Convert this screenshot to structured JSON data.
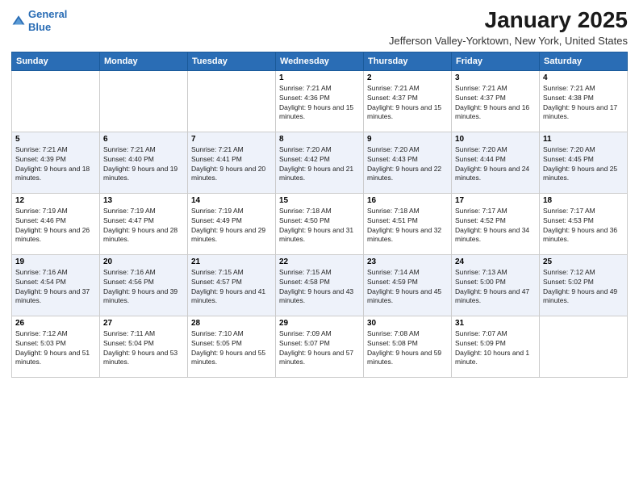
{
  "header": {
    "logo_line1": "General",
    "logo_line2": "Blue",
    "title": "January 2025",
    "subtitle": "Jefferson Valley-Yorktown, New York, United States"
  },
  "days_of_week": [
    "Sunday",
    "Monday",
    "Tuesday",
    "Wednesday",
    "Thursday",
    "Friday",
    "Saturday"
  ],
  "weeks": [
    [
      {
        "day": "",
        "sunrise": "",
        "sunset": "",
        "daylight": ""
      },
      {
        "day": "",
        "sunrise": "",
        "sunset": "",
        "daylight": ""
      },
      {
        "day": "",
        "sunrise": "",
        "sunset": "",
        "daylight": ""
      },
      {
        "day": "1",
        "sunrise": "Sunrise: 7:21 AM",
        "sunset": "Sunset: 4:36 PM",
        "daylight": "Daylight: 9 hours and 15 minutes."
      },
      {
        "day": "2",
        "sunrise": "Sunrise: 7:21 AM",
        "sunset": "Sunset: 4:37 PM",
        "daylight": "Daylight: 9 hours and 15 minutes."
      },
      {
        "day": "3",
        "sunrise": "Sunrise: 7:21 AM",
        "sunset": "Sunset: 4:37 PM",
        "daylight": "Daylight: 9 hours and 16 minutes."
      },
      {
        "day": "4",
        "sunrise": "Sunrise: 7:21 AM",
        "sunset": "Sunset: 4:38 PM",
        "daylight": "Daylight: 9 hours and 17 minutes."
      }
    ],
    [
      {
        "day": "5",
        "sunrise": "Sunrise: 7:21 AM",
        "sunset": "Sunset: 4:39 PM",
        "daylight": "Daylight: 9 hours and 18 minutes."
      },
      {
        "day": "6",
        "sunrise": "Sunrise: 7:21 AM",
        "sunset": "Sunset: 4:40 PM",
        "daylight": "Daylight: 9 hours and 19 minutes."
      },
      {
        "day": "7",
        "sunrise": "Sunrise: 7:21 AM",
        "sunset": "Sunset: 4:41 PM",
        "daylight": "Daylight: 9 hours and 20 minutes."
      },
      {
        "day": "8",
        "sunrise": "Sunrise: 7:20 AM",
        "sunset": "Sunset: 4:42 PM",
        "daylight": "Daylight: 9 hours and 21 minutes."
      },
      {
        "day": "9",
        "sunrise": "Sunrise: 7:20 AM",
        "sunset": "Sunset: 4:43 PM",
        "daylight": "Daylight: 9 hours and 22 minutes."
      },
      {
        "day": "10",
        "sunrise": "Sunrise: 7:20 AM",
        "sunset": "Sunset: 4:44 PM",
        "daylight": "Daylight: 9 hours and 24 minutes."
      },
      {
        "day": "11",
        "sunrise": "Sunrise: 7:20 AM",
        "sunset": "Sunset: 4:45 PM",
        "daylight": "Daylight: 9 hours and 25 minutes."
      }
    ],
    [
      {
        "day": "12",
        "sunrise": "Sunrise: 7:19 AM",
        "sunset": "Sunset: 4:46 PM",
        "daylight": "Daylight: 9 hours and 26 minutes."
      },
      {
        "day": "13",
        "sunrise": "Sunrise: 7:19 AM",
        "sunset": "Sunset: 4:47 PM",
        "daylight": "Daylight: 9 hours and 28 minutes."
      },
      {
        "day": "14",
        "sunrise": "Sunrise: 7:19 AM",
        "sunset": "Sunset: 4:49 PM",
        "daylight": "Daylight: 9 hours and 29 minutes."
      },
      {
        "day": "15",
        "sunrise": "Sunrise: 7:18 AM",
        "sunset": "Sunset: 4:50 PM",
        "daylight": "Daylight: 9 hours and 31 minutes."
      },
      {
        "day": "16",
        "sunrise": "Sunrise: 7:18 AM",
        "sunset": "Sunset: 4:51 PM",
        "daylight": "Daylight: 9 hours and 32 minutes."
      },
      {
        "day": "17",
        "sunrise": "Sunrise: 7:17 AM",
        "sunset": "Sunset: 4:52 PM",
        "daylight": "Daylight: 9 hours and 34 minutes."
      },
      {
        "day": "18",
        "sunrise": "Sunrise: 7:17 AM",
        "sunset": "Sunset: 4:53 PM",
        "daylight": "Daylight: 9 hours and 36 minutes."
      }
    ],
    [
      {
        "day": "19",
        "sunrise": "Sunrise: 7:16 AM",
        "sunset": "Sunset: 4:54 PM",
        "daylight": "Daylight: 9 hours and 37 minutes."
      },
      {
        "day": "20",
        "sunrise": "Sunrise: 7:16 AM",
        "sunset": "Sunset: 4:56 PM",
        "daylight": "Daylight: 9 hours and 39 minutes."
      },
      {
        "day": "21",
        "sunrise": "Sunrise: 7:15 AM",
        "sunset": "Sunset: 4:57 PM",
        "daylight": "Daylight: 9 hours and 41 minutes."
      },
      {
        "day": "22",
        "sunrise": "Sunrise: 7:15 AM",
        "sunset": "Sunset: 4:58 PM",
        "daylight": "Daylight: 9 hours and 43 minutes."
      },
      {
        "day": "23",
        "sunrise": "Sunrise: 7:14 AM",
        "sunset": "Sunset: 4:59 PM",
        "daylight": "Daylight: 9 hours and 45 minutes."
      },
      {
        "day": "24",
        "sunrise": "Sunrise: 7:13 AM",
        "sunset": "Sunset: 5:00 PM",
        "daylight": "Daylight: 9 hours and 47 minutes."
      },
      {
        "day": "25",
        "sunrise": "Sunrise: 7:12 AM",
        "sunset": "Sunset: 5:02 PM",
        "daylight": "Daylight: 9 hours and 49 minutes."
      }
    ],
    [
      {
        "day": "26",
        "sunrise": "Sunrise: 7:12 AM",
        "sunset": "Sunset: 5:03 PM",
        "daylight": "Daylight: 9 hours and 51 minutes."
      },
      {
        "day": "27",
        "sunrise": "Sunrise: 7:11 AM",
        "sunset": "Sunset: 5:04 PM",
        "daylight": "Daylight: 9 hours and 53 minutes."
      },
      {
        "day": "28",
        "sunrise": "Sunrise: 7:10 AM",
        "sunset": "Sunset: 5:05 PM",
        "daylight": "Daylight: 9 hours and 55 minutes."
      },
      {
        "day": "29",
        "sunrise": "Sunrise: 7:09 AM",
        "sunset": "Sunset: 5:07 PM",
        "daylight": "Daylight: 9 hours and 57 minutes."
      },
      {
        "day": "30",
        "sunrise": "Sunrise: 7:08 AM",
        "sunset": "Sunset: 5:08 PM",
        "daylight": "Daylight: 9 hours and 59 minutes."
      },
      {
        "day": "31",
        "sunrise": "Sunrise: 7:07 AM",
        "sunset": "Sunset: 5:09 PM",
        "daylight": "Daylight: 10 hours and 1 minute."
      },
      {
        "day": "",
        "sunrise": "",
        "sunset": "",
        "daylight": ""
      }
    ]
  ]
}
